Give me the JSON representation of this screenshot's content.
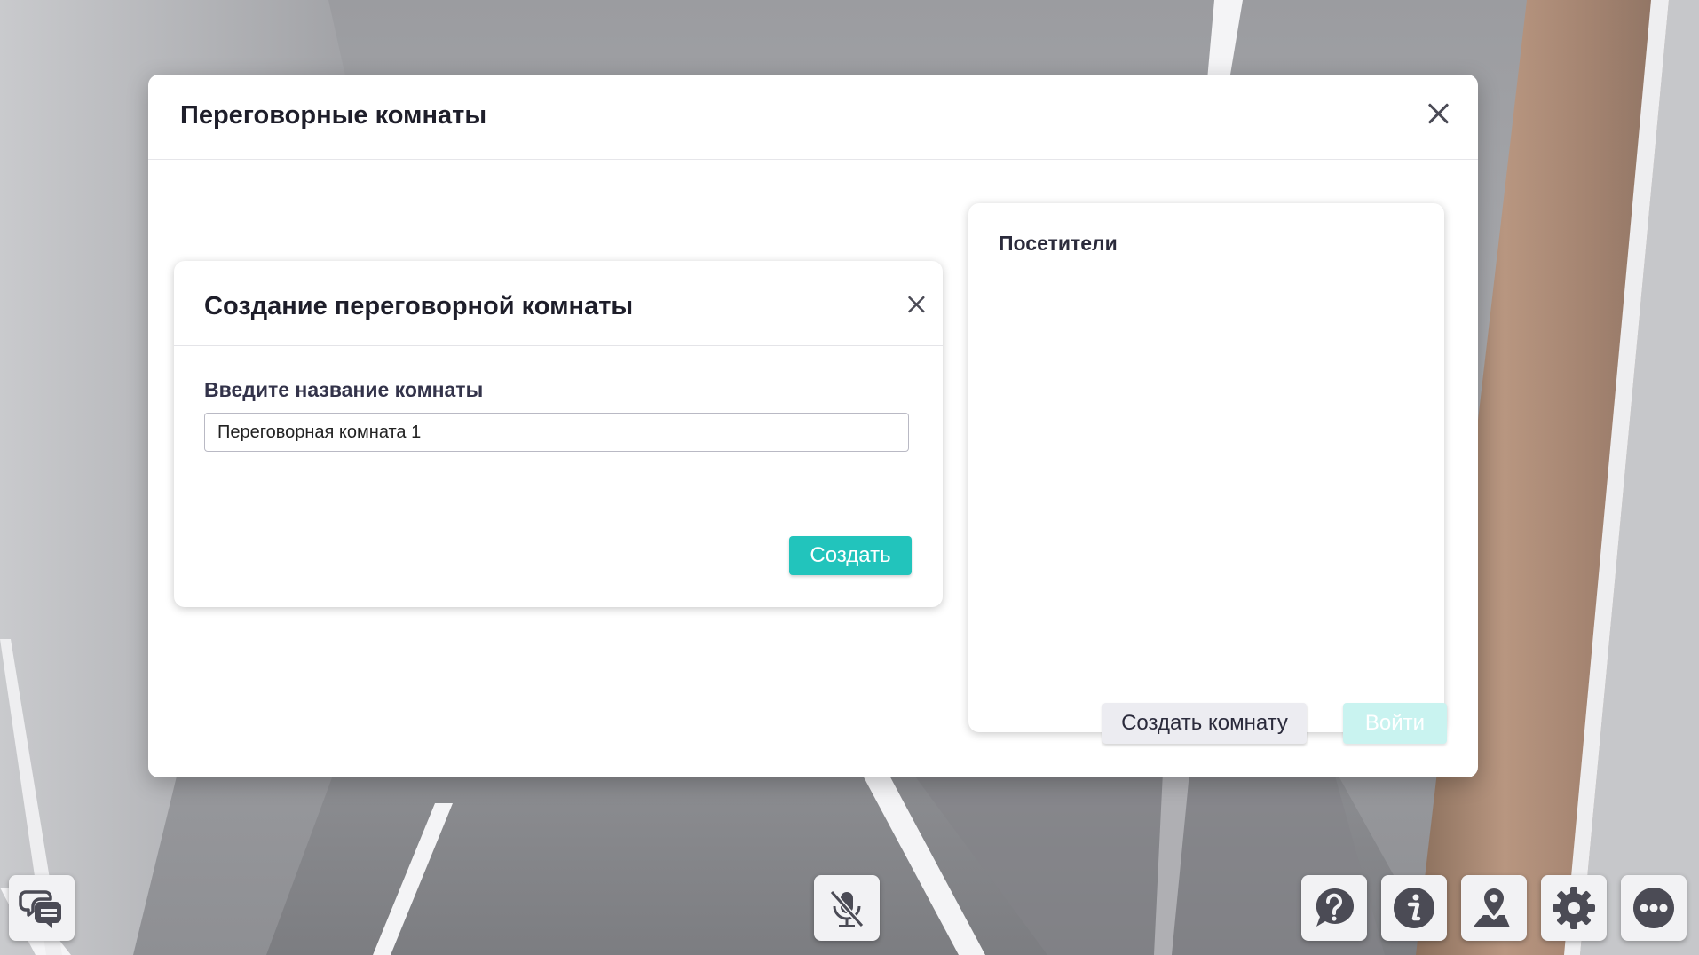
{
  "rooms_modal": {
    "title": "Переговорные комнаты",
    "create_room_label": "Создать комнату",
    "enter_label": "Войти"
  },
  "create_dialog": {
    "title": "Создание переговорной комнаты",
    "field_label": "Введите название комнаты",
    "field_value": "Переговорная комната 1",
    "submit_label": "Создать"
  },
  "visitors": {
    "title": "Посетители"
  },
  "toolbar": {
    "left": [
      "chat-icon"
    ],
    "center": [
      "mic-muted-icon"
    ],
    "right": [
      "help-icon",
      "info-icon",
      "location-icon",
      "settings-icon",
      "more-icon"
    ]
  },
  "colors": {
    "accent": "#22c4bc",
    "accent_disabled": "#c9f3f0",
    "secondary_button": "#ececf1",
    "text_primary": "#1e1e2a"
  }
}
